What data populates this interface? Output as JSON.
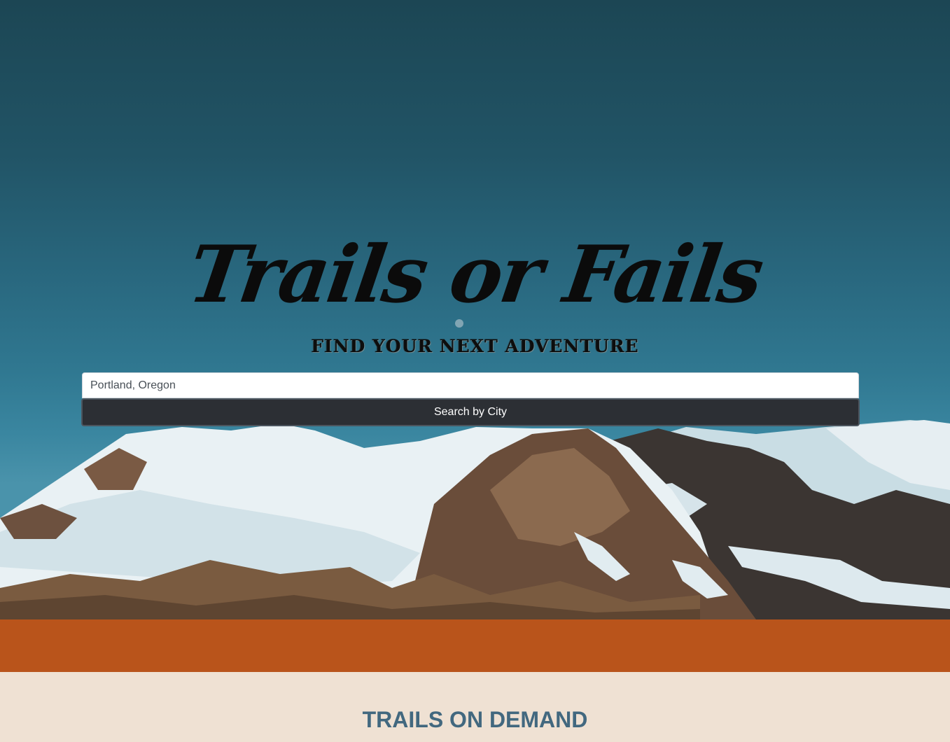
{
  "hero": {
    "logo_title": "Trails or Fails",
    "tagline": "FIND YOUR NEXT ADVENTURE",
    "search": {
      "value": "Portland, Oregon",
      "button_label": "Search by City"
    }
  },
  "sections": {
    "trails_title": "TRAILS ON DEMAND"
  },
  "colors": {
    "sky": "#29687f",
    "accent_orange": "#b9541b",
    "cream": "#efe1d3",
    "title_blue": "#42687f",
    "button_dark": "#2c2f34"
  }
}
